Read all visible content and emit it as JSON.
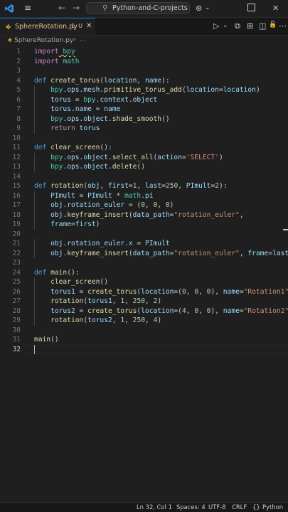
{
  "titlebar": {
    "search_text": "Python-and-C-projects",
    "icons": [
      "vscode-logo",
      "menu-icon",
      "back-arrow-icon",
      "forward-arrow-icon",
      "search-icon",
      "copilot-icon",
      "chevron-down-icon",
      "layout-icon",
      "close-icon"
    ],
    "glyphs": {
      "back": "←",
      "forward": "→",
      "search": "⚲",
      "copilot": "⊛",
      "chevron": "⌄",
      "layout": "▣",
      "close": "✕",
      "menu": "≡"
    }
  },
  "tab": {
    "icon_glyph": "⟡",
    "filename": "SphereRotation.py",
    "status": "1, U",
    "close_glyph": "✕"
  },
  "editor_actions": [
    {
      "name": "run-icon",
      "glyph": "▷"
    },
    {
      "name": "chevron-down-icon",
      "glyph": "⌄"
    },
    {
      "name": "compare-icon",
      "glyph": "⧉"
    },
    {
      "name": "debug-console-icon",
      "glyph": "⊞"
    },
    {
      "name": "split-editor-icon",
      "glyph": "◫"
    },
    {
      "name": "lock-icon",
      "glyph": "🔓"
    },
    {
      "name": "more-icon",
      "glyph": "⋯"
    }
  ],
  "breadcrumb": {
    "icon_glyph": "⟡",
    "file": "SphereRotation.py",
    "separator": "›",
    "more": "..."
  },
  "current_line": 32,
  "lines": [
    {
      "n": 1,
      "tokens": [
        [
          "kwc",
          "import"
        ],
        [
          "",
          ""
        ],
        [
          "mod sq",
          " bpy"
        ]
      ]
    },
    {
      "n": 2,
      "tokens": [
        [
          "kwc",
          "import"
        ],
        [
          "mod",
          " math"
        ]
      ]
    },
    {
      "n": 3,
      "tokens": []
    },
    {
      "n": 4,
      "tokens": [
        [
          "kw",
          "def"
        ],
        [
          "",
          " "
        ],
        [
          "fn",
          "create_torus"
        ],
        [
          "",
          "("
        ],
        [
          "var",
          "location"
        ],
        [
          "",
          ", "
        ],
        [
          "var",
          "name"
        ],
        [
          "",
          "):"
        ]
      ]
    },
    {
      "n": 5,
      "indent": 1,
      "tokens": [
        [
          "mod",
          "bpy"
        ],
        [
          "",
          "."
        ],
        [
          "var",
          "ops"
        ],
        [
          "",
          "."
        ],
        [
          "var",
          "mesh"
        ],
        [
          "",
          "."
        ],
        [
          "fn",
          "primitive_torus_add"
        ],
        [
          "",
          "("
        ],
        [
          "var",
          "location"
        ],
        [
          "",
          "="
        ],
        [
          "var",
          "location"
        ],
        [
          "",
          ")"
        ]
      ]
    },
    {
      "n": 6,
      "indent": 1,
      "tokens": [
        [
          "var",
          "torus"
        ],
        [
          "",
          " = "
        ],
        [
          "mod",
          "bpy"
        ],
        [
          "",
          "."
        ],
        [
          "var",
          "context"
        ],
        [
          "",
          "."
        ],
        [
          "var",
          "object"
        ]
      ]
    },
    {
      "n": 7,
      "indent": 1,
      "tokens": [
        [
          "var",
          "torus"
        ],
        [
          "",
          "."
        ],
        [
          "var",
          "name"
        ],
        [
          "",
          " = "
        ],
        [
          "var",
          "name"
        ]
      ]
    },
    {
      "n": 8,
      "indent": 1,
      "tokens": [
        [
          "mod",
          "bpy"
        ],
        [
          "",
          "."
        ],
        [
          "var",
          "ops"
        ],
        [
          "",
          "."
        ],
        [
          "var",
          "object"
        ],
        [
          "",
          "."
        ],
        [
          "fn",
          "shade_smooth"
        ],
        [
          "",
          "()"
        ]
      ]
    },
    {
      "n": 9,
      "indent": 1,
      "tokens": [
        [
          "kwc",
          "return"
        ],
        [
          "",
          " "
        ],
        [
          "var",
          "torus"
        ]
      ]
    },
    {
      "n": 10,
      "tokens": []
    },
    {
      "n": 11,
      "tokens": [
        [
          "kw",
          "def"
        ],
        [
          "",
          " "
        ],
        [
          "fn",
          "clear_screen"
        ],
        [
          "",
          "():"
        ]
      ]
    },
    {
      "n": 12,
      "indent": 1,
      "tokens": [
        [
          "mod",
          "bpy"
        ],
        [
          "",
          "."
        ],
        [
          "var",
          "ops"
        ],
        [
          "",
          "."
        ],
        [
          "var",
          "object"
        ],
        [
          "",
          "."
        ],
        [
          "fn",
          "select_all"
        ],
        [
          "",
          "("
        ],
        [
          "var",
          "action"
        ],
        [
          "",
          "="
        ],
        [
          "str",
          "'SELECT'"
        ],
        [
          "",
          ")"
        ]
      ]
    },
    {
      "n": 13,
      "indent": 1,
      "tokens": [
        [
          "mod",
          "bpy"
        ],
        [
          "",
          "."
        ],
        [
          "var",
          "ops"
        ],
        [
          "",
          "."
        ],
        [
          "var",
          "object"
        ],
        [
          "",
          "."
        ],
        [
          "fn",
          "delete"
        ],
        [
          "",
          "()"
        ]
      ]
    },
    {
      "n": 14,
      "tokens": []
    },
    {
      "n": 15,
      "tokens": [
        [
          "kw",
          "def"
        ],
        [
          "",
          " "
        ],
        [
          "fn",
          "rotation"
        ],
        [
          "",
          "("
        ],
        [
          "var",
          "obj"
        ],
        [
          "",
          ", "
        ],
        [
          "var",
          "first"
        ],
        [
          "",
          "="
        ],
        [
          "num",
          "1"
        ],
        [
          "",
          ", "
        ],
        [
          "var",
          "last"
        ],
        [
          "",
          "="
        ],
        [
          "num",
          "250"
        ],
        [
          "",
          ", "
        ],
        [
          "var",
          "PImult"
        ],
        [
          "",
          "="
        ],
        [
          "num",
          "2"
        ],
        [
          "",
          "):"
        ]
      ]
    },
    {
      "n": 16,
      "indent": 1,
      "tokens": [
        [
          "var",
          "PImult"
        ],
        [
          "",
          " = "
        ],
        [
          "var",
          "PImult"
        ],
        [
          "",
          " * "
        ],
        [
          "mod",
          "math"
        ],
        [
          "",
          "."
        ],
        [
          "var",
          "pi"
        ]
      ]
    },
    {
      "n": 17,
      "indent": 1,
      "tokens": [
        [
          "var",
          "obj"
        ],
        [
          "",
          "."
        ],
        [
          "var",
          "rotation_euler"
        ],
        [
          "",
          " = ("
        ],
        [
          "num",
          "0"
        ],
        [
          "",
          ", "
        ],
        [
          "num",
          "0"
        ],
        [
          "",
          ", "
        ],
        [
          "num",
          "0"
        ],
        [
          "",
          ")"
        ]
      ]
    },
    {
      "n": 18,
      "indent": 1,
      "tokens": [
        [
          "var",
          "obj"
        ],
        [
          "",
          "."
        ],
        [
          "fn",
          "keyframe_insert"
        ],
        [
          "",
          "("
        ],
        [
          "var",
          "data_path"
        ],
        [
          "",
          "="
        ],
        [
          "str",
          "\"rotation_euler\""
        ],
        [
          "",
          ","
        ]
      ]
    },
    {
      "n": 19,
      "indent": 1,
      "tokens": [
        [
          "var",
          "frame"
        ],
        [
          "",
          "="
        ],
        [
          "var",
          "first"
        ],
        [
          "",
          ")"
        ]
      ]
    },
    {
      "n": 20,
      "tokens": []
    },
    {
      "n": 21,
      "indent": 1,
      "tokens": [
        [
          "var",
          "obj"
        ],
        [
          "",
          "."
        ],
        [
          "var",
          "rotation_euler"
        ],
        [
          "",
          "."
        ],
        [
          "var",
          "x"
        ],
        [
          "",
          " = "
        ],
        [
          "var",
          "PImult"
        ]
      ]
    },
    {
      "n": 22,
      "indent": 1,
      "tokens": [
        [
          "var",
          "obj"
        ],
        [
          "",
          "."
        ],
        [
          "fn",
          "keyframe_insert"
        ],
        [
          "",
          "("
        ],
        [
          "var",
          "data_path"
        ],
        [
          "",
          "="
        ],
        [
          "str",
          "\"rotation_euler\""
        ],
        [
          "",
          ", "
        ],
        [
          "var",
          "frame"
        ],
        [
          "",
          "="
        ],
        [
          "var",
          "last"
        ],
        [
          "",
          ")"
        ]
      ]
    },
    {
      "n": 23,
      "tokens": []
    },
    {
      "n": 24,
      "tokens": [
        [
          "kw",
          "def"
        ],
        [
          "",
          " "
        ],
        [
          "fn",
          "main"
        ],
        [
          "",
          "():"
        ]
      ]
    },
    {
      "n": 25,
      "indent": 1,
      "tokens": [
        [
          "fn",
          "clear_screen"
        ],
        [
          "",
          "()"
        ]
      ]
    },
    {
      "n": 26,
      "indent": 1,
      "tokens": [
        [
          "var",
          "torus1"
        ],
        [
          "",
          " = "
        ],
        [
          "fn",
          "create_torus"
        ],
        [
          "",
          "("
        ],
        [
          "var",
          "location"
        ],
        [
          "",
          "=("
        ],
        [
          "num",
          "0"
        ],
        [
          "",
          ", "
        ],
        [
          "num",
          "0"
        ],
        [
          "",
          ", "
        ],
        [
          "num",
          "0"
        ],
        [
          "",
          "), "
        ],
        [
          "var",
          "name"
        ],
        [
          "",
          "="
        ],
        [
          "str",
          "\"Rotation1\""
        ],
        [
          "",
          ")"
        ]
      ]
    },
    {
      "n": 27,
      "indent": 1,
      "tokens": [
        [
          "fn",
          "rotation"
        ],
        [
          "",
          "("
        ],
        [
          "var",
          "torus1"
        ],
        [
          "",
          ", "
        ],
        [
          "num",
          "1"
        ],
        [
          "",
          ", "
        ],
        [
          "num",
          "250"
        ],
        [
          "",
          ", "
        ],
        [
          "num",
          "2"
        ],
        [
          "",
          ")"
        ]
      ]
    },
    {
      "n": 28,
      "indent": 1,
      "tokens": [
        [
          "var",
          "torus2"
        ],
        [
          "",
          " = "
        ],
        [
          "fn",
          "create_torus"
        ],
        [
          "",
          "("
        ],
        [
          "var",
          "location"
        ],
        [
          "",
          "=("
        ],
        [
          "num",
          "4"
        ],
        [
          "",
          ", "
        ],
        [
          "num",
          "0"
        ],
        [
          "",
          ", "
        ],
        [
          "num",
          "0"
        ],
        [
          "",
          "), "
        ],
        [
          "var",
          "name"
        ],
        [
          "",
          "="
        ],
        [
          "str",
          "\"Rotation2\""
        ],
        [
          "",
          ")"
        ]
      ]
    },
    {
      "n": 29,
      "indent": 1,
      "tokens": [
        [
          "fn",
          "rotation"
        ],
        [
          "",
          "("
        ],
        [
          "var",
          "torus2"
        ],
        [
          "",
          ", "
        ],
        [
          "num",
          "1"
        ],
        [
          "",
          ", "
        ],
        [
          "num",
          "250"
        ],
        [
          "",
          ", "
        ],
        [
          "num",
          "4"
        ],
        [
          "",
          ")"
        ]
      ]
    },
    {
      "n": 30,
      "tokens": []
    },
    {
      "n": 31,
      "tokens": [
        [
          "fn",
          "main"
        ],
        [
          "",
          "()"
        ]
      ]
    },
    {
      "n": 32,
      "tokens": []
    }
  ],
  "statusbar": {
    "position": "Ln 32, Col 1",
    "spaces": "Spaces: 4",
    "encoding": "UTF-8",
    "eol": "CRLF",
    "braces": "{}",
    "language": "Python"
  },
  "colors": {
    "background": "#1f1f1f",
    "accent": "#0078d4",
    "keyword": "#569cd6",
    "control_keyword": "#c586c0",
    "function": "#dcdcaa",
    "string": "#ce9178",
    "number": "#b5cea8",
    "variable": "#9cdcfe",
    "module": "#4ec9b0"
  }
}
